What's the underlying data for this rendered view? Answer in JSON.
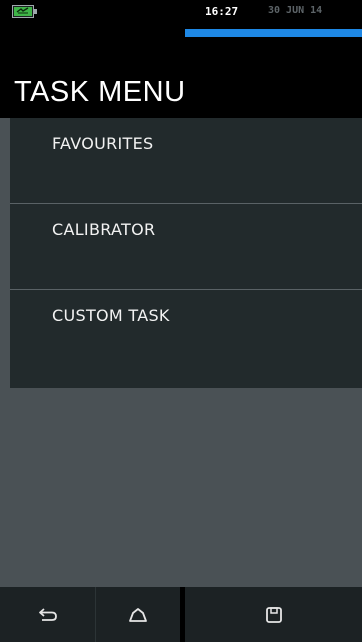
{
  "status_bar": {
    "time": "16:27",
    "date": "30 JUN 14",
    "battery_icon": "battery-charging-icon",
    "battery_color": "#3fb548",
    "progress_color": "#1e88e5"
  },
  "header": {
    "title": "TASK MENU"
  },
  "menu": {
    "items": [
      {
        "label": "FAVOURITES"
      },
      {
        "label": "CALIBRATOR"
      },
      {
        "label": "CUSTOM TASK"
      }
    ]
  },
  "nav_bar": {
    "back_icon": "back-arrow-icon",
    "home_icon": "home-icon",
    "save_icon": "save-icon"
  },
  "colors": {
    "background": "#4a5155",
    "menu_item_bg": "#222a2c",
    "bar_bg": "#000000"
  }
}
